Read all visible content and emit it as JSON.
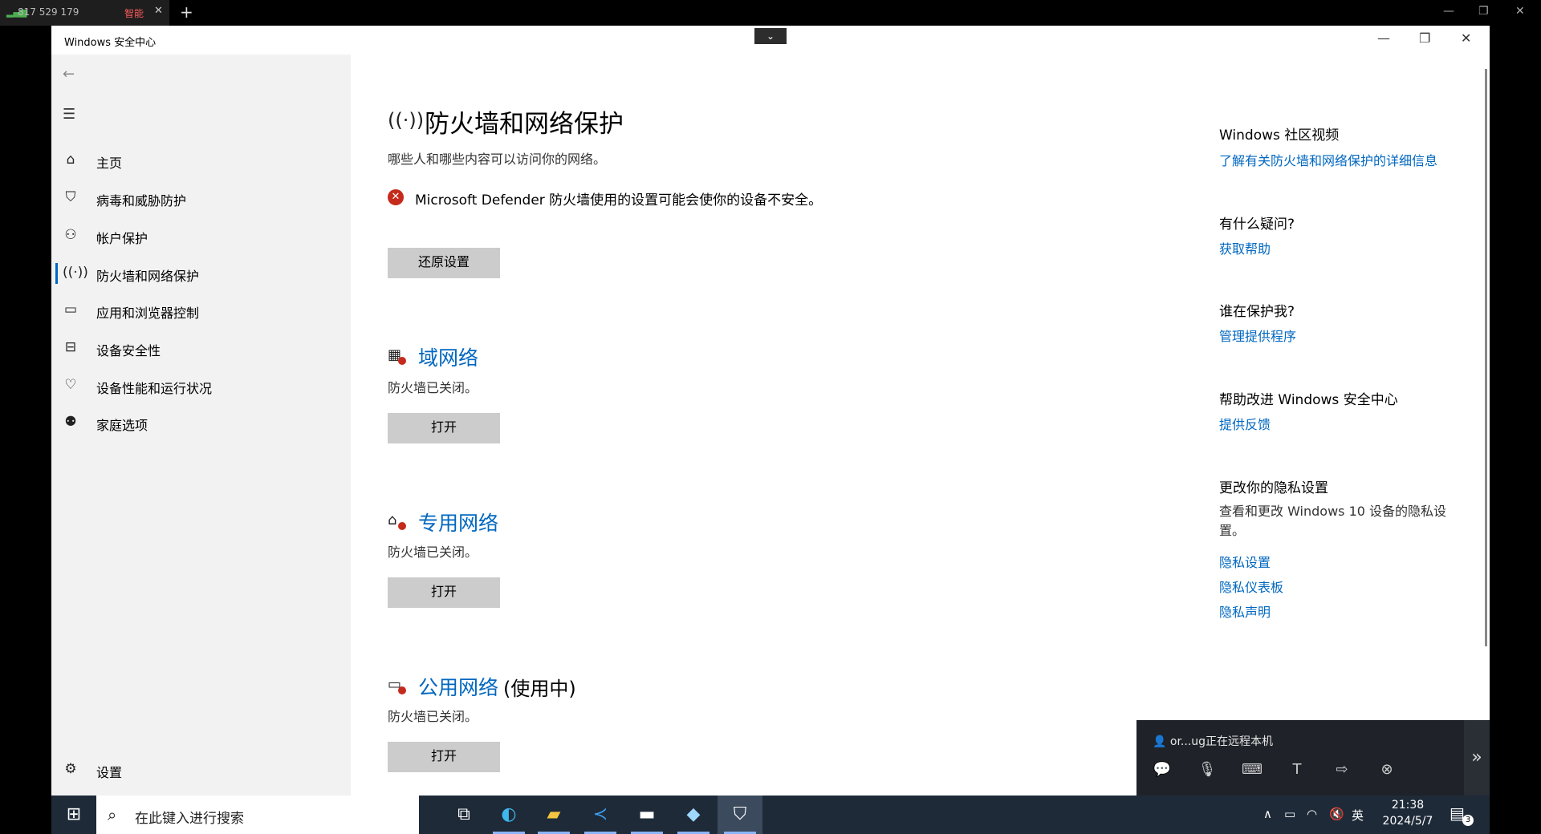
{
  "remote_bar": {
    "tab_id": "817 529 179",
    "tab_mode": "智能"
  },
  "window": {
    "title": "Windows 安全中心"
  },
  "sidebar": {
    "items": [
      {
        "label": "主页",
        "icon": "home-icon"
      },
      {
        "label": "病毒和威胁防护",
        "icon": "shield-icon"
      },
      {
        "label": "帐户保护",
        "icon": "person-icon"
      },
      {
        "label": "防火墙和网络保护",
        "icon": "antenna-icon"
      },
      {
        "label": "应用和浏览器控制",
        "icon": "browser-window-icon"
      },
      {
        "label": "设备安全性",
        "icon": "laptop-icon"
      },
      {
        "label": "设备性能和运行状况",
        "icon": "heart-icon"
      },
      {
        "label": "家庭选项",
        "icon": "family-icon"
      }
    ],
    "settings_label": "设置"
  },
  "main": {
    "title": "防火墙和网络保护",
    "subtitle": "哪些人和哪些内容可以访问你的网络。",
    "warning": "Microsoft Defender 防火墙使用的设置可能会使你的设备不安全。",
    "restore_button": "还原设置",
    "networks": [
      {
        "name": "域网络",
        "suffix": "",
        "status": "防火墙已关闭。",
        "button": "打开"
      },
      {
        "name": "专用网络",
        "suffix": "",
        "status": "防火墙已关闭。",
        "button": "打开"
      },
      {
        "name": "公用网络",
        "suffix": "(使用中)",
        "status": "防火墙已关闭。",
        "button": "打开"
      }
    ]
  },
  "right_pane": {
    "community_heading": "Windows 社区视频",
    "community_link": "了解有关防火墙和网络保护的详细信息",
    "question_heading": "有什么疑问?",
    "help_link": "获取帮助",
    "protect_heading": "谁在保护我?",
    "providers_link": "管理提供程序",
    "improve_heading": "帮助改进 Windows 安全中心",
    "feedback_link": "提供反馈",
    "privacy_heading": "更改你的隐私设置",
    "privacy_text": "查看和更改 Windows 10 设备的隐私设置。",
    "privacy_settings_link": "隐私设置",
    "privacy_dashboard_link": "隐私仪表板",
    "privacy_statement_link": "隐私声明"
  },
  "rdp_popup": {
    "info": "or...ug正在远程本机"
  },
  "taskbar": {
    "search_placeholder": "在此键入进行搜索",
    "ime": "英",
    "time": "21:38",
    "date": "2024/5/7",
    "notification_count": "3"
  }
}
